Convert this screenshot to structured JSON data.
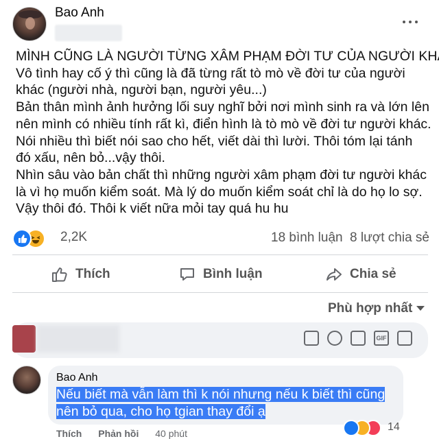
{
  "post": {
    "author": "Bao Anh",
    "lines": [
      "MÌNH CŨNG LÀ NGƯỜI TỪNG XÂM PHẠM ĐỜI TƯ CỦA NGƯỜI KHÁC.",
      "Vô tình hay cố ý thì cũng là đã từng rất tò mò về đời tư của người",
      "khác (người nhà, người bạn, người yêu...)",
      "Bản thân mình ảnh hưởng lối suy nghĩ bởi nơi mình sinh ra và lớn lên",
      "nên mình có nhiều tính rất kì, điển hình là tò mò về đời tư người khác.",
      "Nói nhiều thì biết nói sao cho hết, viết dài thì lười. Thôi tóm lại tánh",
      "đó xấu, nên bỏ...vậy thôi.",
      "Nhìn sâu vào bản chất thì những người xâm phạm đời tư người khác",
      "là vì họ muốn kiểm soát. Mà lý do muốn kiểm soát chỉ là do họ lo sợ.",
      "Vậy thôi đó. Thôi k viết nữa mỏi tay quá hu hu"
    ],
    "reaction_count": "2,2K",
    "comment_count": "18 bình luận",
    "share_count": "8 lượt chia sẻ"
  },
  "actions": {
    "like": "Thích",
    "comment": "Bình luận",
    "share": "Chia sẻ"
  },
  "sort_label": "Phù hợp nhất",
  "comment": {
    "author": "Bao Anh",
    "lines": [
      "Nếu biết mà vẫn làm thì k nói nhưng nếu k biết thì cũng",
      "nên bỏ qua, cho họ tgian thay đổi ạ"
    ],
    "reaction_count": "14",
    "like": "Thích",
    "reply": "Phản hồi",
    "time": "40 phút"
  },
  "colors": {
    "accent": "#1877f2",
    "highlight": "#3a7cf5",
    "secondary_text": "#65676b"
  }
}
